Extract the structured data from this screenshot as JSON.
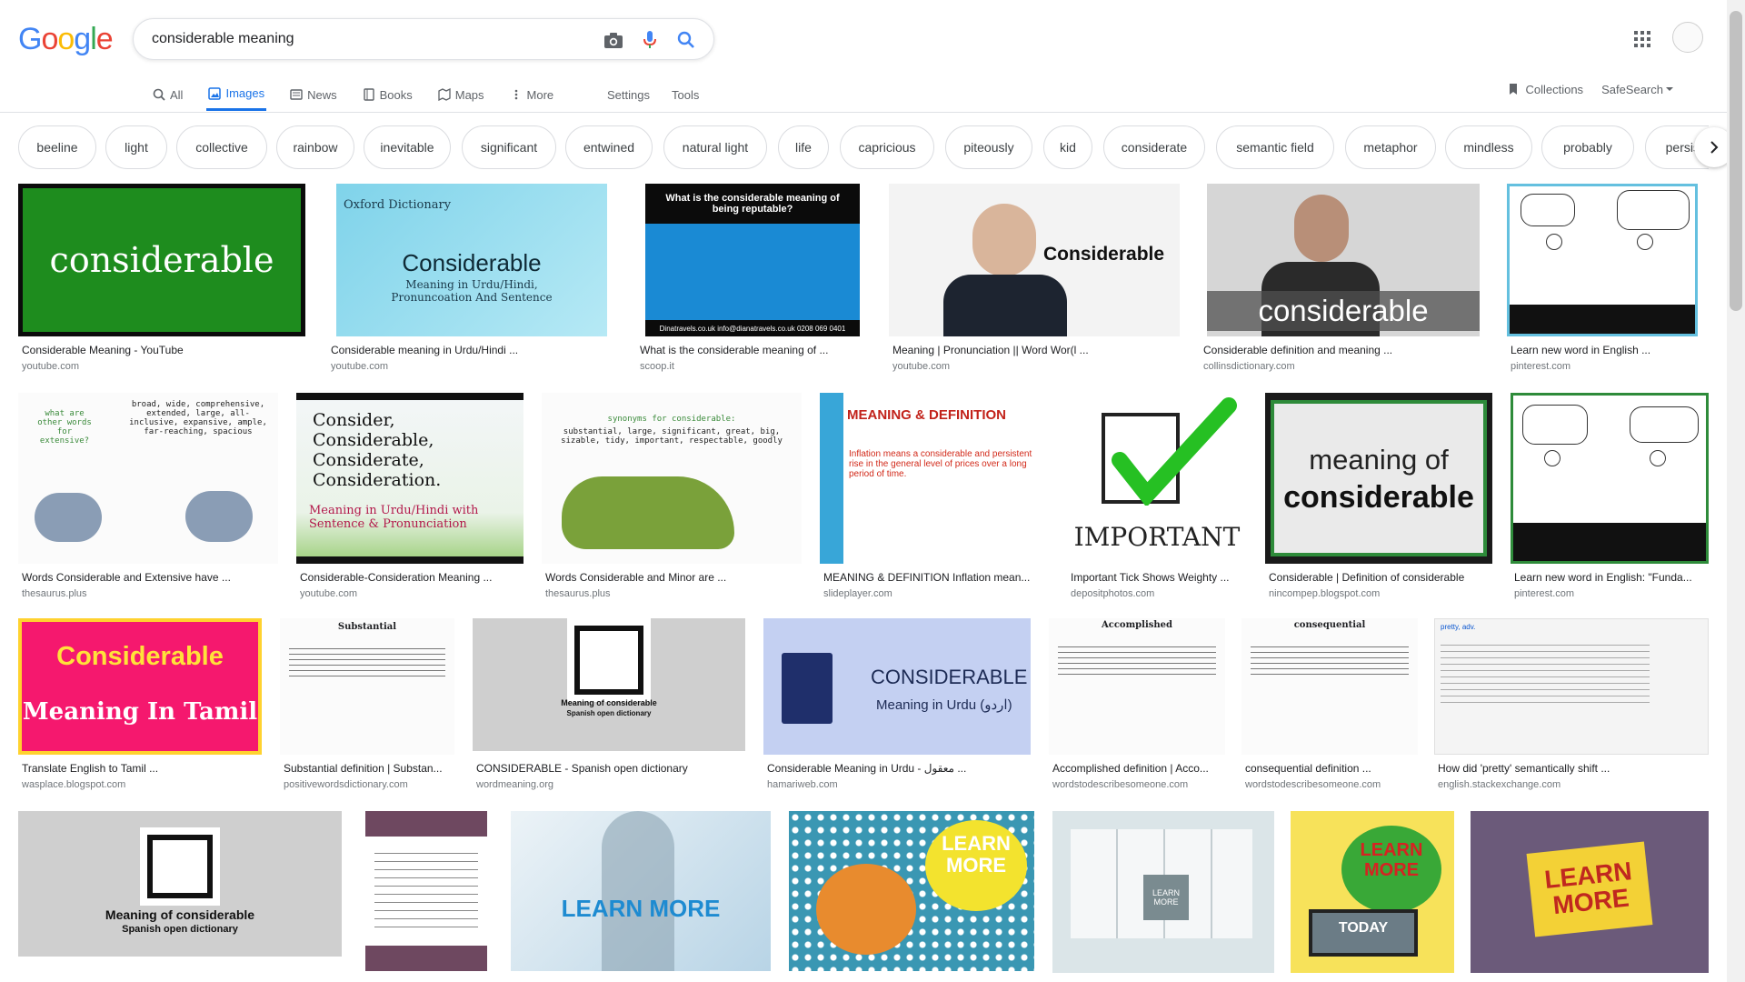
{
  "logo": "Google",
  "search": {
    "query": "considerable meaning"
  },
  "tabs": [
    {
      "label": "All"
    },
    {
      "label": "Images"
    },
    {
      "label": "News"
    },
    {
      "label": "Books"
    },
    {
      "label": "Maps"
    },
    {
      "label": "More"
    }
  ],
  "tools": {
    "settings": "Settings",
    "tools": "Tools",
    "collections": "Collections",
    "safesearch": "SafeSearch"
  },
  "chips": [
    "beeline",
    "light",
    "collective",
    "rainbow",
    "inevitable",
    "significant",
    "entwined",
    "natural light",
    "life",
    "capricious",
    "piteously",
    "kid",
    "considerate",
    "semantic field",
    "metaphor",
    "mindless",
    "probably",
    "persistent"
  ],
  "results": [
    {
      "caption": "Considerable Meaning - YouTube",
      "domain": "youtube.com",
      "thumb_text": "considerable"
    },
    {
      "caption": "Considerable meaning in Urdu/Hindi ...",
      "domain": "youtube.com",
      "thumb_title": "Oxford Dictionary",
      "thumb_text": "Considerable",
      "thumb_sub": "Meaning in Urdu/Hindi, Pronuncoation And Sentence"
    },
    {
      "caption": "What is the considerable meaning of ...",
      "domain": "scoop.it",
      "thumb_text": "What is the considerable meaning of being reputable?",
      "thumb_sub": "Dinatravels.co.uk   info@dianatravels.co.uk   0208 069 0401"
    },
    {
      "caption": "Meaning | Pronunciation || Word Wor(l ...",
      "domain": "youtube.com",
      "thumb_text": "Considerable"
    },
    {
      "caption": "Considerable definition and meaning ...",
      "domain": "collinsdictionary.com",
      "thumb_text": "considerable"
    },
    {
      "caption": "Learn new word in English ...",
      "domain": "pinterest.com"
    },
    {
      "caption": "Words Considerable and Extensive have ...",
      "domain": "thesaurus.plus",
      "thumb_text": "what are other words for extensive?",
      "thumb_sub": "broad, wide, comprehensive, extended, large, all-inclusive, expansive, ample, far-reaching, spacious"
    },
    {
      "caption": "Considerable-Consideration Meaning ...",
      "domain": "youtube.com",
      "thumb_text": "Consider, Considerable, Considerate, Consideration.",
      "thumb_sub": "Meaning in Urdu/Hindi with Sentence & Pronunciation"
    },
    {
      "caption": "Words Considerable and Minor are ...",
      "domain": "thesaurus.plus",
      "thumb_text": "synonyms for considerable:",
      "thumb_sub": "substantial, large, significant, great, big, sizable, tidy, important, respectable, goodly"
    },
    {
      "caption": "MEANING & DEFINITION Inflation mean...",
      "domain": "slideplayer.com",
      "thumb_text": "MEANING & DEFINITION",
      "thumb_sub": "Inflation means a considerable and persistent rise in the general level of prices over a long period of time."
    },
    {
      "caption": "Important Tick Shows Weighty ...",
      "domain": "depositphotos.com",
      "thumb_text": "IMPORTANT"
    },
    {
      "caption": "Considerable | Definition of considerable",
      "domain": "nincompep.blogspot.com",
      "thumb_text": "meaning of",
      "thumb_sub": "considerable"
    },
    {
      "caption": "Learn new word in English: \"Funda...",
      "domain": "pinterest.com"
    },
    {
      "caption": "Translate English to Tamil ...",
      "domain": "wasplace.blogspot.com",
      "thumb_text": "Considerable",
      "thumb_sub": "Meaning In Tamil"
    },
    {
      "caption": "Substantial definition | Substan...",
      "domain": "positivewordsdictionary.com",
      "thumb_text": "Substantial"
    },
    {
      "caption": "CONSIDERABLE - Spanish open dictionary",
      "domain": "wordmeaning.org",
      "thumb_text": "Meaning of considerable",
      "thumb_sub": "Spanish open dictionary"
    },
    {
      "caption": "Considerable Meaning in Urdu - معقول ...",
      "domain": "hamariweb.com",
      "thumb_text": "CONSIDERABLE",
      "thumb_sub": "Meaning in Urdu (اردو)"
    },
    {
      "caption": "Accomplished definition | Acco...",
      "domain": "wordstodescribesomeone.com",
      "thumb_text": "Accomplished"
    },
    {
      "caption": "consequential definition ...",
      "domain": "wordstodescribesomeone.com",
      "thumb_text": "consequential"
    },
    {
      "caption": "How did 'pretty' semantically shift ...",
      "domain": "english.stackexchange.com",
      "thumb_text": "pretty, adv."
    },
    {
      "caption": "",
      "domain": "",
      "thumb_text": "Meaning of considerable",
      "thumb_sub": "Spanish open dictionary"
    },
    {
      "caption": "",
      "domain": ""
    },
    {
      "caption": "",
      "domain": "",
      "thumb_text": "LEARN MORE"
    },
    {
      "caption": "",
      "domain": "",
      "thumb_text": "LEARN MORE"
    },
    {
      "caption": "",
      "domain": "",
      "thumb_text": "LEARN MORE"
    },
    {
      "caption": "",
      "domain": "",
      "thumb_text": "LEARN MORE",
      "thumb_sub": "TODAY"
    },
    {
      "caption": "",
      "domain": "",
      "thumb_text": "LEARN MORE"
    }
  ],
  "colors": {
    "accent": "#1a73e8",
    "border": "#dfe1e5"
  }
}
